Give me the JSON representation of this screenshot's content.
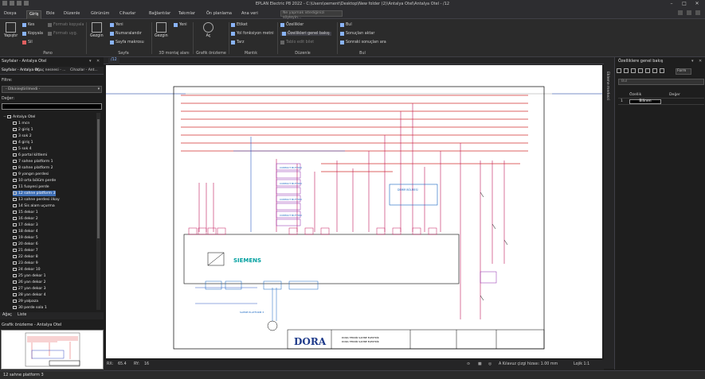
{
  "title": "EPLAN Electric P8 2022 - C:\\Users\\oement\\Desktop\\New folder (2)\\Antalya Otel\\Antalya Otel - /12",
  "menu_tabs": [
    "Dosya",
    "Giriş",
    "Ekle",
    "Düzenle",
    "Görünüm",
    "Cihazlar",
    "Bağlantılar",
    "Takımlar",
    "Ön planlama",
    "Ana veri"
  ],
  "search_placeholder": "Ne yapmak istediğinizi söyleyin...",
  "ribbon": {
    "paste": "Yapıştır",
    "cut": "Kes",
    "copy": "Kopyala",
    "copy_format": "Formatı kopyala",
    "apply_format": "Formatı uyg.",
    "delete": "Sil",
    "clipboard_group": "Pano",
    "navigator": "Gezgin",
    "new_page": "Yeni",
    "numbering": "Numaralandır",
    "page_macro": "Sayfa makrosu",
    "page_group": "Sayfa",
    "navigator2": "Gezgin",
    "new_3d": "Yeni",
    "layout_3d_group": "3D montaj alanı",
    "view": "Aç",
    "graphic_preview_group": "Grafik önizleme",
    "level": "Etiket",
    "apply_to_level": "Yol fonksiyon metni",
    "wire": "Tarz",
    "logic_group": "Mantık",
    "properties": "Özellikler",
    "show_properties": "Özellikleri genel bakış",
    "table_edit": "Tablo edit bilet",
    "edit_group": "Düzenle",
    "find": "Bul",
    "find_results": "Sonuçları aktar",
    "next_result": "Sonraki sonuçları ara",
    "find_group": "Bul"
  },
  "left_panel": {
    "title": "Sayfalar - Antalya Otel",
    "subtabs": [
      "Sayfalar - Antalya Ot...",
      "Ağaç nesnesi - ...",
      "Cihazlar - Ant..."
    ],
    "filter_label": "Filtre:",
    "filter_value": "- Etkinleştirilmedi -",
    "value_label": "Değer:",
    "project": "Antalya Otel",
    "pages": [
      "1 mcn",
      "2 giriş 1",
      "3 sok 2",
      "4 giriş 1",
      "5 sok 4",
      "6 portal kiltlemi",
      "7 sahne platform 1",
      "8 sahne platform 2",
      "9 yangın perdesi",
      "10 orta bölüm perde",
      "11 fuayesi perde",
      "12 sahne platform 3",
      "13 sahne perdesi ilkay",
      "14 Sis alam uçurma",
      "15 dekor 1",
      "16 dekor 2",
      "17 dekor 3",
      "18 dekor 4",
      "19 dekor 5",
      "20 dekor 6",
      "21 dekor 7",
      "22 dekor 8",
      "23 dekor 9",
      "24 dekor 10",
      "25 yan dekor 1",
      "26 yan dekor 2",
      "27 yan dekor 3",
      "28 yan dekor 4",
      "29 yalpaza",
      "30 perde sola 1"
    ],
    "selected_index": 11,
    "bottom_tabs": [
      "Ağaç",
      "Liste"
    ],
    "preview_title": "Grafik önizleme - Antalya Otel"
  },
  "document": {
    "tab": "/12",
    "status_rx": "RX:",
    "status_rx_val": "65.4",
    "status_ry": "RY:",
    "status_ry_val": "16",
    "grid": "A Kılavuz çizgi hizası: 1.00 mm",
    "logic": "Lojik 1:1"
  },
  "right_tab": "Ekleme merkezi",
  "right_panel": {
    "title": "Özelliklere genel bakış",
    "form_label": "Form",
    "search_placeholder": "Bul",
    "col_property": "Özellik",
    "col_value": "Değer",
    "row_index": "1",
    "row_value": "Bilinen"
  },
  "schematic": {
    "brand": "SIEMENS",
    "logo": "DORA",
    "company_line1": "DORA TEKNİK SAHNE ELEKTRİK",
    "company_line2": "DORA TEKNİK SAHNE ELEKTRİK",
    "contact_label": "CONTACT BUTTON",
    "main_motor": "SAHNE PLATFORM 3",
    "box_label": "DEMİR BÖLMESİ"
  },
  "status_text": "12 sahne platform 3"
}
